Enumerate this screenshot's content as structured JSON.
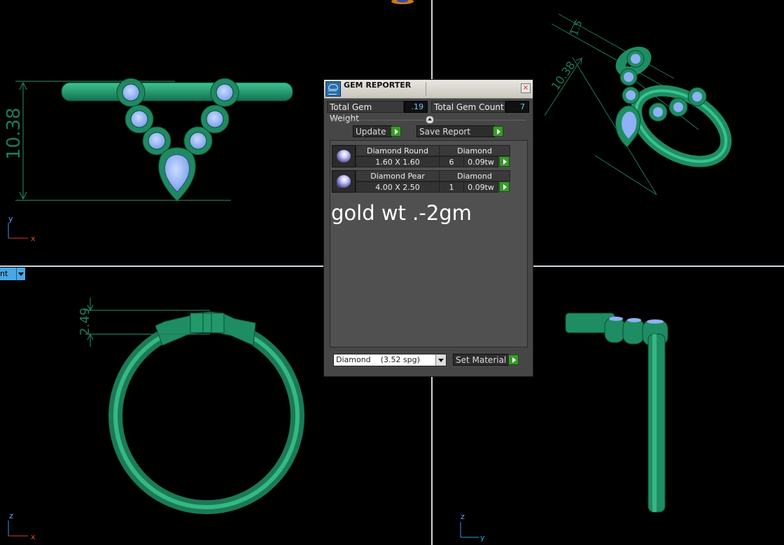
{
  "viewport": {
    "dimension_top_left": "10.38",
    "dimension_top_right_a": "10.38",
    "dimension_top_right_b": "1.5",
    "dimension_bottom_left": "2.49",
    "axis_top_left": [
      "y",
      "x"
    ],
    "axis_bottom_left": [
      "z",
      "x"
    ],
    "axis_bottom_right": [
      "z",
      "y"
    ],
    "view_selector_label": "nt"
  },
  "gem_reporter": {
    "title": "GEM REPORTER",
    "close_label": "×",
    "total_gem_weight_label": "Total Gem Weight",
    "total_gem_weight_value": ".19",
    "total_gem_count_label": "Total Gem Count",
    "total_gem_count_value": "7",
    "update_label": "Update",
    "save_report_label": "Save Report",
    "gems": [
      {
        "shape": "Diamond Round",
        "material": "Diamond",
        "size": "1.60 X 1.60",
        "count": "6",
        "weight": "0.09tw"
      },
      {
        "shape": "Diamond Pear",
        "material": "Diamond",
        "size": "4.00 X 2.50",
        "count": "1",
        "weight": "0.09tw"
      }
    ],
    "note": "gold wt .-2gm",
    "material_select_value": "Diamond    (3.52 spg)",
    "set_material_label": "Set Material"
  },
  "colors": {
    "ring_green": "#27a074",
    "gem_blue": "#8fb1f5",
    "panel_bg": "#464646",
    "value_blue": "#69c5ff",
    "go_green": "#3a9a2a"
  }
}
